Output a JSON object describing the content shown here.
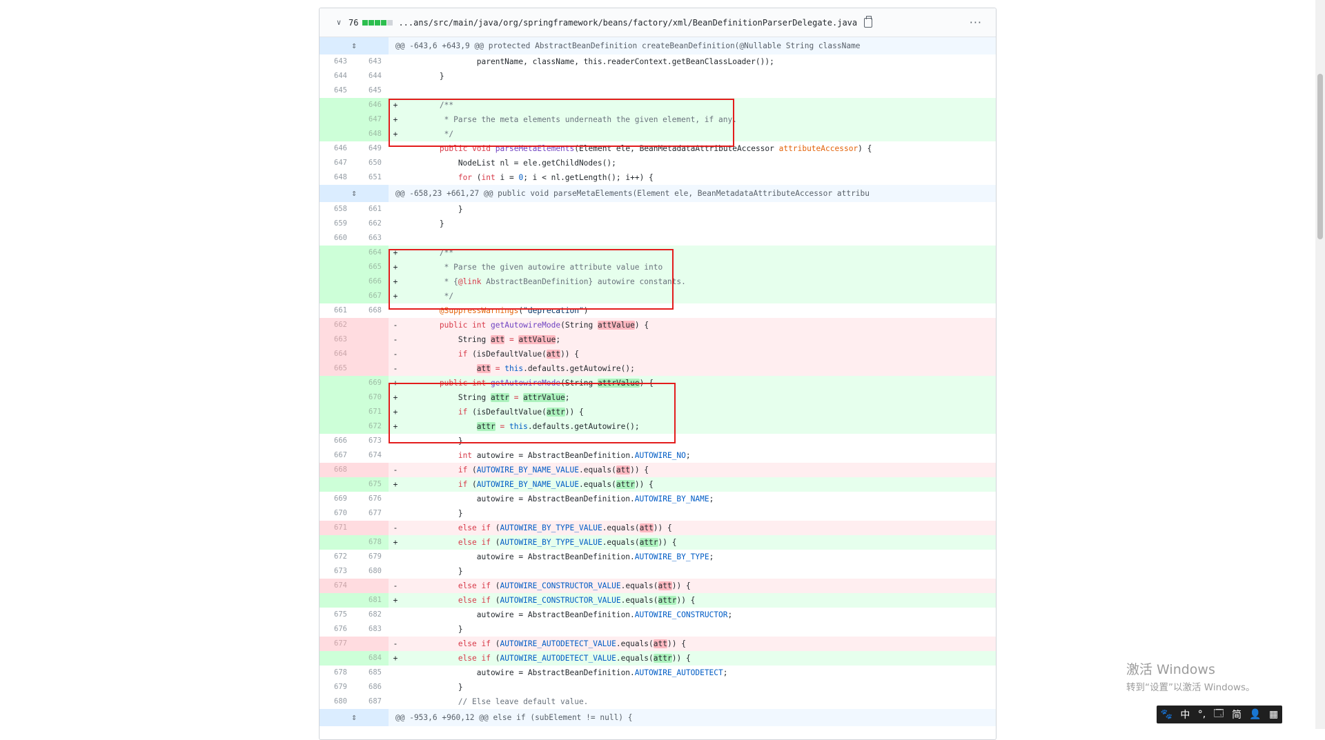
{
  "file": {
    "additions_count": "76",
    "path": "...ans/src/main/java/org/springframework/beans/factory/xml/BeanDefinitionParserDelegate.java",
    "diffstat_colors": [
      "#2cbe4e",
      "#2cbe4e",
      "#2cbe4e",
      "#2cbe4e",
      "#d1d5da"
    ],
    "more_label": "···"
  },
  "hunks": [
    "@@ -643,6 +643,9 @@ protected AbstractBeanDefinition createBeanDefinition(@Nullable String className",
    "@@ -658,23 +661,27 @@ public void parseMetaElements(Element ele, BeanMetadataAttributeAccessor attribu",
    "@@ -953,6 +960,12 @@ else if (subElement != null) {"
  ],
  "lines": {
    "l643": {
      "old": "643",
      "new": "643",
      "sign": "",
      "code": "                parentName, className, this.readerContext.getBeanClassLoader());"
    },
    "l644": {
      "old": "644",
      "new": "644",
      "sign": "",
      "code": "        }"
    },
    "l645": {
      "old": "645",
      "new": "645",
      "sign": "",
      "code": ""
    },
    "l646": {
      "old": "",
      "new": "646",
      "sign": "+",
      "code": "        /**"
    },
    "l647": {
      "old": "",
      "new": "647",
      "sign": "+",
      "code": "         * Parse the meta elements underneath the given element, if any."
    },
    "l648": {
      "old": "",
      "new": "648",
      "sign": "+",
      "code": "         */"
    },
    "l649": {
      "old": "646",
      "new": "649",
      "sign": "",
      "code": ""
    },
    "l650": {
      "old": "647",
      "new": "650",
      "sign": "",
      "code": "            NodeList nl = ele.getChildNodes();"
    },
    "l651": {
      "old": "648",
      "new": "651",
      "sign": "",
      "code": ""
    },
    "l661": {
      "old": "658",
      "new": "661",
      "sign": "",
      "code": "            }"
    },
    "l662": {
      "old": "659",
      "new": "662",
      "sign": "",
      "code": "        }"
    },
    "l663": {
      "old": "660",
      "new": "663",
      "sign": "",
      "code": ""
    },
    "l664": {
      "old": "",
      "new": "664",
      "sign": "+",
      "code": "        /**"
    },
    "l665": {
      "old": "",
      "new": "665",
      "sign": "+",
      "code": "         * Parse the given autowire attribute value into"
    },
    "l666": {
      "old": "",
      "new": "666",
      "sign": "+",
      "code": ""
    },
    "l667": {
      "old": "",
      "new": "667",
      "sign": "+",
      "code": "         */"
    },
    "l668": {
      "old": "661",
      "new": "668",
      "sign": "",
      "code": ""
    },
    "d662": {
      "old": "662",
      "new": "",
      "sign": "-",
      "code": ""
    },
    "d663": {
      "old": "663",
      "new": "",
      "sign": "-",
      "code": ""
    },
    "d664": {
      "old": "664",
      "new": "",
      "sign": "-",
      "code": ""
    },
    "d665": {
      "old": "665",
      "new": "",
      "sign": "-",
      "code": ""
    },
    "a669": {
      "old": "",
      "new": "669",
      "sign": "+",
      "code": ""
    },
    "a670": {
      "old": "",
      "new": "670",
      "sign": "+",
      "code": ""
    },
    "a671": {
      "old": "",
      "new": "671",
      "sign": "+",
      "code": ""
    },
    "a672": {
      "old": "",
      "new": "672",
      "sign": "+",
      "code": ""
    },
    "l673": {
      "old": "666",
      "new": "673",
      "sign": "",
      "code": "            }"
    },
    "l674": {
      "old": "667",
      "new": "674",
      "sign": "",
      "code": ""
    },
    "d668": {
      "old": "668",
      "new": "",
      "sign": "-",
      "code": ""
    },
    "a675": {
      "old": "",
      "new": "675",
      "sign": "+",
      "code": ""
    },
    "l676": {
      "old": "669",
      "new": "676",
      "sign": "",
      "code": ""
    },
    "l677": {
      "old": "670",
      "new": "677",
      "sign": "",
      "code": "            }"
    },
    "d671": {
      "old": "671",
      "new": "",
      "sign": "-",
      "code": ""
    },
    "a678": {
      "old": "",
      "new": "678",
      "sign": "+",
      "code": ""
    },
    "l679": {
      "old": "672",
      "new": "679",
      "sign": "",
      "code": ""
    },
    "l680": {
      "old": "673",
      "new": "680",
      "sign": "",
      "code": "            }"
    },
    "d674": {
      "old": "674",
      "new": "",
      "sign": "-",
      "code": ""
    },
    "a681": {
      "old": "",
      "new": "681",
      "sign": "+",
      "code": ""
    },
    "l682": {
      "old": "675",
      "new": "682",
      "sign": "",
      "code": ""
    },
    "l683": {
      "old": "676",
      "new": "683",
      "sign": "",
      "code": "            }"
    },
    "d677": {
      "old": "677",
      "new": "",
      "sign": "-",
      "code": ""
    },
    "a684": {
      "old": "",
      "new": "684",
      "sign": "+",
      "code": ""
    },
    "l685": {
      "old": "678",
      "new": "685",
      "sign": "",
      "code": ""
    },
    "l686": {
      "old": "679",
      "new": "686",
      "sign": "",
      "code": "            }"
    },
    "l687": {
      "old": "680",
      "new": "687",
      "sign": "",
      "code": "            // Else leave default value."
    }
  },
  "tokens": {
    "this": "this",
    "public": "public",
    "void": "void",
    "int": "int",
    "for": "for",
    "if": "if",
    "else": "else",
    "parseMetaElements": "parseMetaElements",
    "getAutowireMode": "getAutowireMode",
    "attributeAccessor": "attributeAccessor",
    "parseMeta_args1": "(Element ele, BeanMetadataAttributeAccessor ",
    "parseMeta_tail": ") {",
    "for_a": "            ",
    "for_b": " (",
    "for_c": "int",
    "for_d": " i = ",
    "for_e": "0",
    "for_f": "; i < nl.getLength(); i++) {",
    "link_a": "         * {",
    "link_b": "@link",
    "link_c": " AbstractBeanDefinition} autowire constants.",
    "suppress": "@SuppressWarnings",
    "suppress_arg": "\"deprecation\"",
    "string_kw": "String",
    "att": "att",
    "attr": "attr",
    "attValue": "attValue",
    "attrValue": "attrValue",
    "isDefaultValue_open": "(isDefaultValue(",
    "close_brace": ")) {",
    "defaults_tail": ".defaults.getAutowire();",
    "autowire_decl": " autowire = AbstractBeanDefinition.",
    "AUTOWIRE_NO": "AUTOWIRE_NO",
    "AUTOWIRE_BY_NAME_VALUE": "AUTOWIRE_BY_NAME_VALUE",
    "AUTOWIRE_BY_TYPE_VALUE": "AUTOWIRE_BY_TYPE_VALUE",
    "AUTOWIRE_CONSTRUCTOR_VALUE": "AUTOWIRE_CONSTRUCTOR_VALUE",
    "AUTOWIRE_AUTODETECT_VALUE": "AUTOWIRE_AUTODETECT_VALUE",
    "AUTOWIRE_BY_NAME": "AUTOWIRE_BY_NAME",
    "AUTOWIRE_BY_TYPE": "AUTOWIRE_BY_TYPE",
    "AUTOWIRE_CONSTRUCTOR": "AUTOWIRE_CONSTRUCTOR",
    "AUTOWIRE_AUTODETECT": "AUTOWIRE_AUTODETECT",
    "equals_open": ".equals(",
    "assign_prefix": "                autowire = AbstractBeanDefinition.",
    "semicolon": ";",
    "eq": " = ",
    "paren_open": "(",
    "string_param_close": ") {"
  },
  "watermark": {
    "line1": "激活 Windows",
    "line2": "转到“设置”以激活 Windows。"
  },
  "ime": [
    "🐾",
    "中",
    "°,",
    "🗔",
    "简",
    "👤",
    "▦"
  ]
}
